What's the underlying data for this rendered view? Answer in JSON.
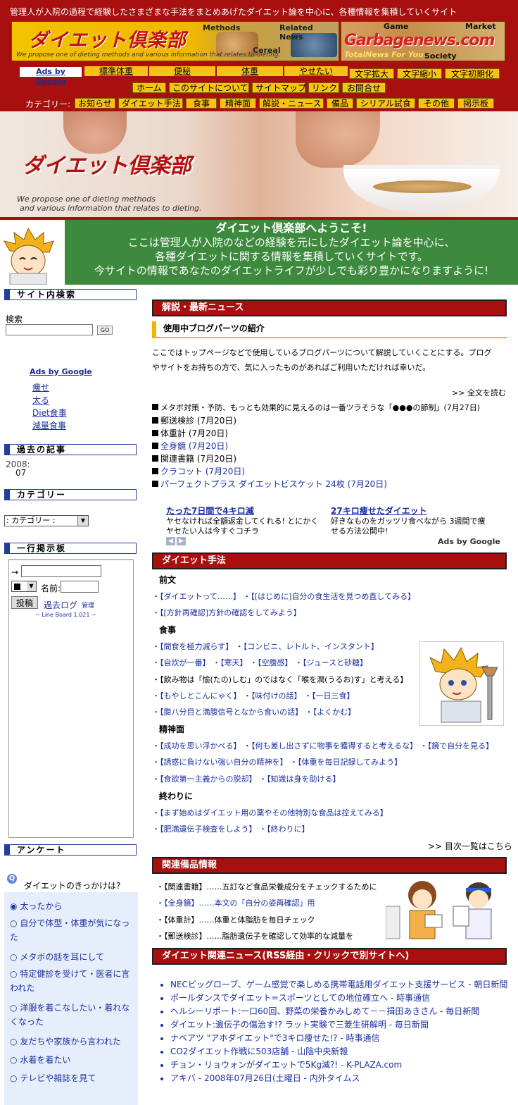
{
  "header": {
    "tagline": "管理人が入院の過程で経験したさまざまな手法をまとめあげたダイエット論を中心に、各種情報を集積していくサイト",
    "banner_left": {
      "logo": "ダイエット倶楽部",
      "sub": "We propose one of dieting methods and various information that relates to dieting.",
      "methods": "Methods",
      "related_news": "Related News",
      "cereal": "Cereal"
    },
    "banner_right": {
      "game": "Game",
      "market": "Market",
      "name": "Garbagenews.com",
      "tag": "TotalNews For You",
      "society": "Society"
    }
  },
  "nav": {
    "ads_label": "Ads by Google",
    "keywords": [
      "標準体重",
      "便秘",
      "体重",
      "やせたい"
    ],
    "font_buttons": [
      "文字拡大",
      "文字縮小",
      "文字初期化"
    ],
    "links": [
      "ホーム",
      "このサイトについて",
      "サイトマップ",
      "リンク",
      "お問合せ"
    ],
    "category_label": "カテゴリー:",
    "categories": [
      "お知らせ",
      "ダイエット手法",
      "食事",
      "精神面",
      "解説・ニュース",
      "備品",
      "シリアル試食",
      "その他",
      "掲示板"
    ]
  },
  "hero": {
    "logo": "ダイエット倶楽部",
    "sub1": "We propose one of dieting methods",
    "sub2": "and various information that relates to dieting."
  },
  "welcome": {
    "title": "ダイエット倶楽部へようこそ!",
    "line1": "ここは管理人が入院のなどの経験を元にしたダイエット論を中心に、",
    "line2": "各種ダイエットに関する情報を集積していくサイトです。",
    "line3": "今サイトの情報であなたのダイエットライフが少しでも彩り豊かになりますように!"
  },
  "sidebar": {
    "search_title": "サイト内検索",
    "search_label": "検索",
    "search_go": "GO",
    "ads_label": "Ads by Google",
    "ads_links": [
      "痩せ",
      "太る",
      "Diet食事",
      "減量食事"
    ],
    "archive_title": "過去の記事",
    "archive_year": "2008:",
    "archive_month": "07",
    "category_title": "カテゴリー",
    "category_select": ": カテゴリー :",
    "board_title": "一行掲示板",
    "board_arrow": "→",
    "board_name_label": "名前:",
    "board_post": "投稿",
    "board_log": "過去ログ",
    "board_admin": "管理",
    "board_credit": "~ Line Board 1.021 ~",
    "survey_title": "アンケート",
    "survey_question": "ダイエットのきっかけは?",
    "survey_options": [
      "太ったから",
      "自分で体型・体重が気になった",
      "メタボの話を耳にして",
      "特定健診を受けて・医者に言われた",
      "洋服を着こなしたい・着れなくなった",
      "友だちや家族から言われた",
      "水着を着たい",
      "テレビや雑誌を見て"
    ]
  },
  "main": {
    "news_title": "解説・最新ニュース",
    "article_title": "使用中ブログパーツの紹介",
    "article_body1": "ここではトップページなどで使用しているブログパーツについて解説していくことにする。ブログ",
    "article_body2": "やサイトをお持ちの方で、気に入ったものがあればご利用いただければ幸いだ。",
    "read_more": ">> 全文を読む",
    "recent": [
      "メタボ対策・予防、もっとも効果的に見えるのは一番ツラそうな「●●●の節制」(7月27日)",
      "郵送検診 (7月20日)",
      "体重計 (7月20日)",
      "全身鏡 (7月20日)",
      "関連書籍 (7月20日)",
      "クラコット (7月20日)",
      "パーフェクトプラス ダイエットビスケット 24枚 (7月20日)"
    ],
    "ad1_title": "たった7日間で4キロ減",
    "ad1_body1": "ヤセなければ全額返金してくれる! とにかく",
    "ad1_body2": "ヤセたい人は今すぐコチラ",
    "ad2_title": "27キロ痩せたダイエット",
    "ad2_body1": "好きなものをガッツリ食べながら 3週間で痩",
    "ad2_body2": "せる方法公開中!",
    "ads_google": "Ads by Google",
    "methods_title": "ダイエット手法",
    "sec_intro": "前文",
    "intro_1": "・【ダイエットって……】 ・【[はじめに]自分の食生活を見つめ直してみる】",
    "intro_2": "・【[方針再確認]方針の確認をしてみよう】",
    "sec_food": "食事",
    "food_1": "・【間食を極力減らす】 ・【コンビニ、レトルト、インスタント】",
    "food_2": "・【自炊が一番】 ・【寒天】 ・【空腹感】 ・【ジュースと砂糖】",
    "food_3": "・【飲み物は「愉(たの)しむ」のではなく「喉を潤(うるお)す」と考える】",
    "food_4": "・【もやしとこんにゃく】 ・【味付けの話】 ・【一日三食】",
    "food_5": "・【腹八分目と満腹信号となから食いの話】 ・【よくかむ】",
    "sec_mind": "精神面",
    "mind_1": "・【成功を思い浮かべる】 ・【何も差し出さずに物事を獲得すると考えるな】 ・【鏡で自分を見る】",
    "mind_2": "・【誘惑に負けない強い自分の精神を】 ・【体重を毎日記録してみよう】",
    "mind_3": "・【食欲第一主義からの脱却】 ・【知識は身を助ける】",
    "sec_end": "終わりに",
    "end_1": "・【まず始めはダイエット用の薬やその他特別な食品は控えてみる】",
    "end_2": "・【肥満遺伝子検査をしよう】 ・【終わりに】",
    "toc": ">> 目次一覧はこちら",
    "equip_title": "関連備品情報",
    "equip": [
      "・【関連書籍】……五訂など食品栄養成分をチェックするために",
      "・【全身鏡】……本文の「自分の姿再確認」用",
      "・【体重計】……体重と体脂肪を毎日チェック",
      "・【郵送検診】……脂肪遺伝子を確認して効率的な減量を"
    ],
    "rss_title": "ダイエット関連ニュース(RSS経由・クリックで別サイトへ)",
    "rss": [
      "NECビッグローブ、ゲーム感覚で楽しめる携帯電話用ダイエット支援サービス - 朝日新聞",
      "ポールダンスでダイエット=スポーツとしての地位確立へ - 時事通信",
      "ヘルシーリポート:一口60回、野菜の栄養かみしめて－－揖田あきさん - 毎日新聞",
      "ダイエット:遺伝子の傷治す!? ラット実験で三菱生研解明 - 毎日新聞",
      "ナベアツ \"アホダイエット\"で3キロ痩せた!? - 時事通信",
      "CO2ダイエット作戦に503店舗 - 山陰中央新報",
      "チョン・リョウォンがダイエットで5Kg減?! - K-PLAZA.com",
      "アキバ - 2008年07月26日(土曜日 - 内外タイムス"
    ]
  },
  "colors": {
    "brand_red": "#a80f0f",
    "nav_yellow": "#f6c214",
    "welcome_green": "#3d8a3e",
    "link_blue": "#1a2fa0",
    "sidebar_blue": "#233e9a"
  }
}
